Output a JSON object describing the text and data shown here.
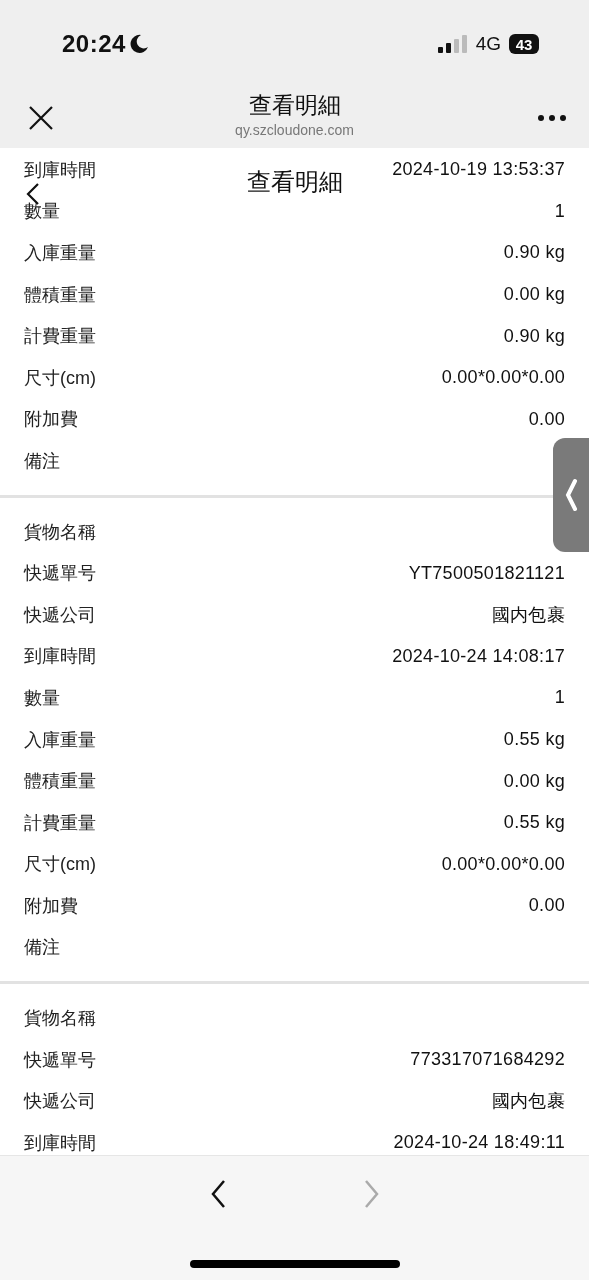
{
  "status_bar": {
    "time": "20:24",
    "network": "4G",
    "battery": "43"
  },
  "nav_bar": {
    "title": "查看明細",
    "url": "qy.szcloudone.com"
  },
  "page_header": {
    "title": "查看明細"
  },
  "sections": [
    {
      "rows": [
        {
          "label": "到庫時間",
          "value": "2024-10-19 13:53:37"
        },
        {
          "label": "數量",
          "value": "1"
        },
        {
          "label": "入庫重量",
          "value": "0.90 kg"
        },
        {
          "label": "體積重量",
          "value": "0.00 kg"
        },
        {
          "label": "計費重量",
          "value": "0.90 kg"
        },
        {
          "label": "尺寸(cm)",
          "value": "0.00*0.00*0.00"
        },
        {
          "label": "附加費",
          "value": "0.00"
        },
        {
          "label": "備注"
        }
      ]
    },
    {
      "rows": [
        {
          "label": "貨物名稱"
        },
        {
          "label": "快遞單号",
          "value": "YT7500501821121"
        },
        {
          "label": "快遞公司",
          "value": "國内包裹"
        },
        {
          "label": "到庫時間",
          "value": "2024-10-24 14:08:17"
        },
        {
          "label": "數量",
          "value": "1"
        },
        {
          "label": "入庫重量",
          "value": "0.55 kg"
        },
        {
          "label": "體積重量",
          "value": "0.00 kg"
        },
        {
          "label": "計費重量",
          "value": "0.55 kg"
        },
        {
          "label": "尺寸(cm)",
          "value": "0.00*0.00*0.00"
        },
        {
          "label": "附加費",
          "value": "0.00"
        },
        {
          "label": "備注"
        }
      ]
    },
    {
      "rows": [
        {
          "label": "貨物名稱"
        },
        {
          "label": "快遞單号",
          "value": "773317071684292"
        },
        {
          "label": "快遞公司",
          "value": "國内包裹"
        },
        {
          "label": "到庫時間",
          "value": "2024-10-24 18:49:11"
        }
      ]
    }
  ],
  "toolbar": {
    "back": {
      "disabled": false
    },
    "forward": {
      "disabled": true
    }
  }
}
